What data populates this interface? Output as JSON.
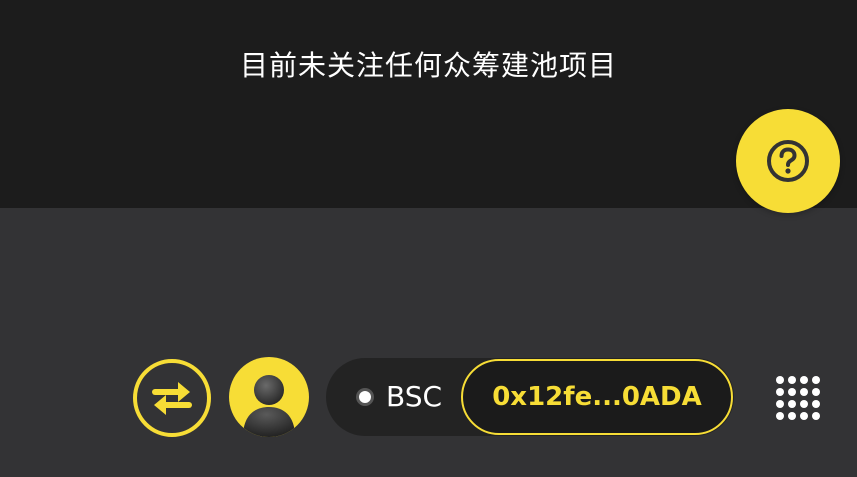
{
  "empty_state": {
    "message": "目前未关注任何众筹建池项目"
  },
  "help_button": {
    "icon": "question-circle-icon"
  },
  "bottom_bar": {
    "swap_icon": "swap-arrows-icon",
    "avatar_icon": "user-avatar-icon",
    "network": "BSC",
    "address": "0x12fe...0ADA",
    "menu_icon": "apps-grid-icon"
  },
  "colors": {
    "accent": "#f7dd36",
    "top_background": "#1c1c1c",
    "bottom_background": "#333335",
    "pill_background": "#232323"
  }
}
